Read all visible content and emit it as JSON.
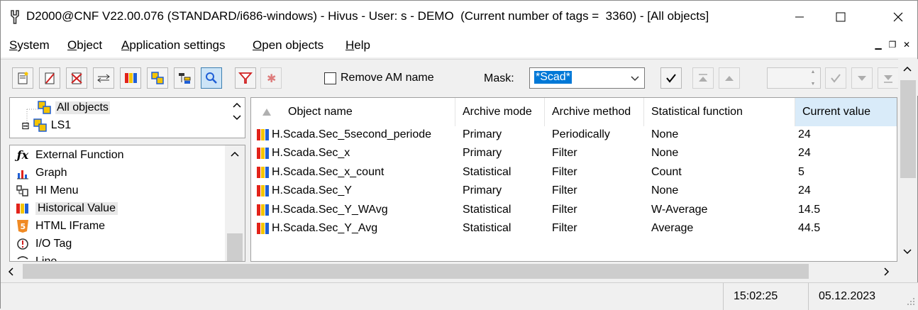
{
  "window": {
    "title": "D2000@CNF V22.00.076 (STANDARD/i686-windows) - Hivus - User: s - DEMO  (Current number of tags =  3360) - [All objects]"
  },
  "menu": {
    "items": [
      {
        "label": "System",
        "ul": "S",
        "rest": "ystem"
      },
      {
        "label": "Object",
        "ul": "O",
        "rest": "bject"
      },
      {
        "label": "Application settings",
        "ul": "A",
        "rest": "pplication settings"
      },
      {
        "label": "Open objects",
        "ul": "O",
        "rest": "pen objects"
      },
      {
        "label": "Help",
        "ul": "H",
        "rest": "elp"
      }
    ]
  },
  "toolbar": {
    "remove_am_label": "Remove AM name",
    "remove_am_checked": false,
    "mask_label": "Mask:",
    "mask_value": "*Scad*",
    "icons": [
      "new-object-icon",
      "edit-object-icon",
      "delete-object-icon",
      "move-icon",
      "historical-value-icon",
      "structure-icon",
      "tree-icon",
      "search-icon",
      "filter-icon",
      "clear-filter-icon",
      "confirm-icon",
      "first-icon",
      "previous-icon",
      "accept-icon",
      "next-icon",
      "last-icon"
    ]
  },
  "tree": {
    "items": [
      {
        "label": "All objects",
        "expander": ""
      },
      {
        "label": "LS1",
        "expander": "⊟"
      }
    ]
  },
  "types": {
    "items": [
      {
        "label": "External Function",
        "icon": "external-function-icon"
      },
      {
        "label": "Graph",
        "icon": "graph-icon"
      },
      {
        "label": "HI Menu",
        "icon": "hi-menu-icon"
      },
      {
        "label": "Historical Value",
        "icon": "historical-value-icon"
      },
      {
        "label": "HTML IFrame",
        "icon": "html-iframe-icon"
      },
      {
        "label": "I/O Tag",
        "icon": "io-tag-icon"
      },
      {
        "label": "Line",
        "icon": "line-icon"
      }
    ],
    "selected": "Historical Value"
  },
  "grid": {
    "columns": [
      "Object name",
      "Archive mode",
      "Archive method",
      "Statistical function",
      "Current value"
    ],
    "sorted_column": "Current value",
    "rows": [
      [
        "H.Scada.Sec_5second_periode",
        "Primary",
        "Periodically",
        "None",
        "24"
      ],
      [
        "H.Scada.Sec_x",
        "Primary",
        "Filter",
        "None",
        "24"
      ],
      [
        "H.Scada.Sec_x_count",
        "Statistical",
        "Filter",
        "Count",
        "5"
      ],
      [
        "H.Scada.Sec_Y",
        "Primary",
        "Filter",
        "None",
        "24"
      ],
      [
        "H.Scada.Sec_Y_WAvg",
        "Statistical",
        "Filter",
        "W-Average",
        "14.5"
      ],
      [
        "H.Scada.Sec_Y_Avg",
        "Statistical",
        "Filter",
        "Average",
        "44.5"
      ]
    ]
  },
  "status": {
    "time": "15:02:25",
    "date": "05.12.2023"
  },
  "colors": {
    "selection": "#0078d7",
    "sorted_header": "#d9ebf9",
    "hv_red": "#e2231a",
    "hv_yellow": "#f5c400",
    "hv_blue": "#1f5fd6"
  }
}
